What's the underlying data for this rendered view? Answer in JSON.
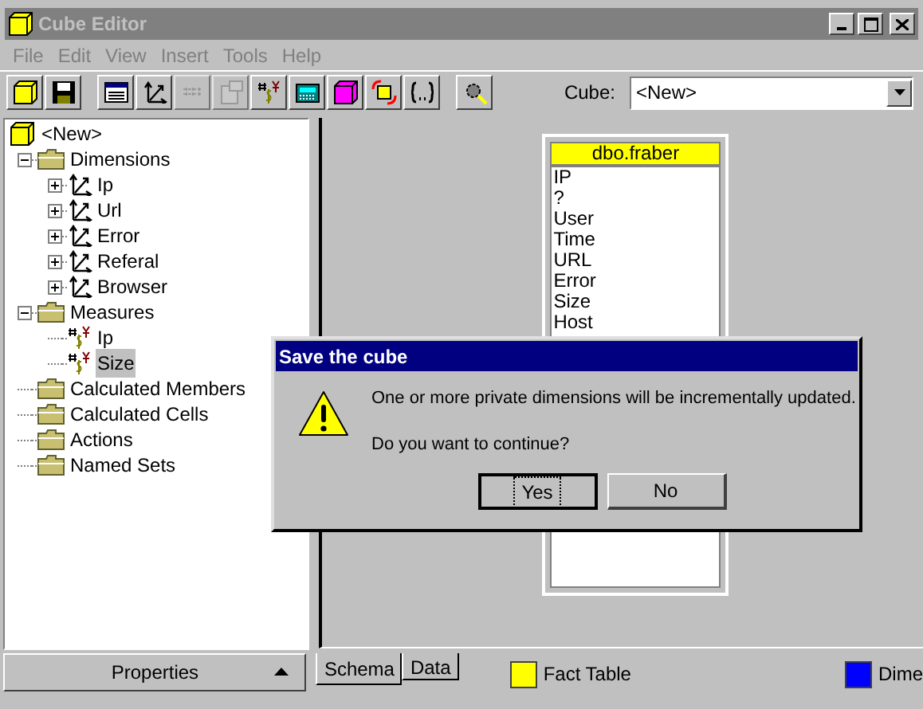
{
  "window": {
    "title": "Cube Editor",
    "active": false
  },
  "menu": [
    {
      "label": "File"
    },
    {
      "label": "Edit"
    },
    {
      "label": "View"
    },
    {
      "label": "Insert"
    },
    {
      "label": "Tools"
    },
    {
      "label": "Help"
    }
  ],
  "toolbar": [
    {
      "kind": "cube"
    },
    {
      "kind": "save"
    },
    {
      "kind": "separator"
    },
    {
      "kind": "table"
    },
    {
      "kind": "dimension"
    },
    {
      "kind": "grid",
      "disabled": true
    },
    {
      "kind": "properties",
      "disabled": true
    },
    {
      "kind": "measure"
    },
    {
      "kind": "calculator"
    },
    {
      "kind": "pinkcube"
    },
    {
      "kind": "process"
    },
    {
      "kind": "braces"
    },
    {
      "kind": "separator"
    },
    {
      "kind": "wizard"
    }
  ],
  "cube_select": {
    "label": "Cube:",
    "value": "<New>"
  },
  "tree": {
    "label": "<New>",
    "children": [
      {
        "label": "Dimensions",
        "kind": "folder",
        "expanded": true,
        "children": [
          {
            "label": "Ip",
            "kind": "dimension",
            "expanded": false,
            "selected": false
          },
          {
            "label": "Url",
            "kind": "dimension",
            "expanded": false,
            "selected": false
          },
          {
            "label": "Error",
            "kind": "dimension",
            "expanded": false,
            "selected": false
          },
          {
            "label": "Referal",
            "kind": "dimension",
            "expanded": false,
            "selected": false
          },
          {
            "label": "Browser",
            "kind": "dimension",
            "expanded": false,
            "selected": false
          }
        ]
      },
      {
        "label": "Measures",
        "kind": "folder",
        "expanded": true,
        "children": [
          {
            "label": "Ip",
            "kind": "measure",
            "selected": false
          },
          {
            "label": "Size",
            "kind": "measure",
            "selected": true
          }
        ]
      },
      {
        "label": "Calculated Members",
        "kind": "folder"
      },
      {
        "label": "Calculated Cells",
        "kind": "folder"
      },
      {
        "label": "Actions",
        "kind": "folder"
      },
      {
        "label": "Named Sets",
        "kind": "folder"
      }
    ]
  },
  "properties_button": {
    "label": "Properties"
  },
  "fact_table": {
    "name": "dbo.fraber",
    "columns": [
      "IP",
      "?",
      "User",
      "Time",
      "URL",
      "Error",
      "Size",
      "Host"
    ]
  },
  "tabs": [
    {
      "label": "Schema",
      "selected": true
    },
    {
      "label": "Data",
      "selected": false
    }
  ],
  "legend": [
    {
      "label": "Fact Table",
      "color": "#ffff00"
    },
    {
      "label": "Dime",
      "color": "#0000ff"
    }
  ],
  "dialog": {
    "title": "Save the cube",
    "message": "One or more private dimensions will be incrementally updated.",
    "question": "Do you want to continue?",
    "buttons": [
      {
        "label": "Yes",
        "default": true
      },
      {
        "label": "No",
        "default": false
      }
    ]
  }
}
